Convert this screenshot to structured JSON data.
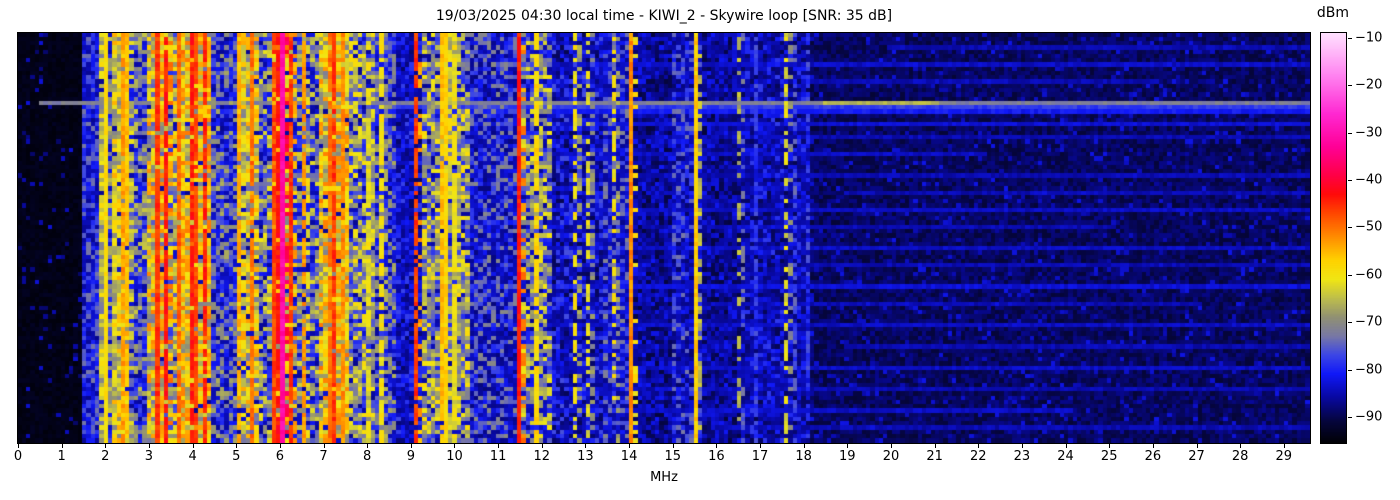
{
  "figure": {
    "title": "19/03/2025 04:30 local time - KIWI_2 - Skywire loop [SNR: 35 dB]",
    "xlabel": "MHz",
    "colorbar_label": "dBm",
    "background": "#ffffff"
  },
  "chart_data": {
    "type": "heatmap",
    "title": "19/03/2025 04:30 local time - KIWI_2 - Skywire loop [SNR: 35 dB]",
    "xlabel": "MHz",
    "ylabel": "",
    "colorbar_label": "dBm",
    "x_range_mhz": [
      0,
      29.6
    ],
    "xticks": [
      0,
      1,
      2,
      3,
      4,
      5,
      6,
      7,
      8,
      9,
      10,
      11,
      12,
      13,
      14,
      15,
      16,
      17,
      18,
      19,
      20,
      21,
      22,
      23,
      24,
      25,
      26,
      27,
      28,
      29
    ],
    "colorbar_ticks": [
      -10,
      -20,
      -30,
      -40,
      -50,
      -60,
      -70,
      -80,
      -90
    ],
    "colorbar_tick_labels": [
      "−10",
      "−20",
      "−30",
      "−40",
      "−50",
      "−60",
      "−70",
      "−80",
      "−90"
    ],
    "value_range_dbm": [
      -95.5,
      -9
    ],
    "grid": {
      "cols": 300,
      "rows": 96,
      "seed": 1337
    },
    "colormap_stops": [
      [
        -96,
        [
          0,
          0,
          0
        ]
      ],
      [
        -91,
        [
          5,
          5,
          60
        ]
      ],
      [
        -86,
        [
          8,
          8,
          160
        ]
      ],
      [
        -81,
        [
          16,
          24,
          248
        ]
      ],
      [
        -77,
        [
          60,
          70,
          230
        ]
      ],
      [
        -73,
        [
          120,
          120,
          165
        ]
      ],
      [
        -69,
        [
          145,
          145,
          115
        ]
      ],
      [
        -65,
        [
          190,
          190,
          75
        ]
      ],
      [
        -61,
        [
          240,
          230,
          20
        ]
      ],
      [
        -57,
        [
          255,
          210,
          0
        ]
      ],
      [
        -52,
        [
          255,
          140,
          0
        ]
      ],
      [
        -47,
        [
          255,
          70,
          0
        ]
      ],
      [
        -43,
        [
          255,
          10,
          10
        ]
      ],
      [
        -39,
        [
          255,
          0,
          70
        ]
      ],
      [
        -33,
        [
          255,
          0,
          150
        ]
      ],
      [
        -26,
        [
          255,
          40,
          210
        ]
      ],
      [
        -18,
        [
          255,
          130,
          240
        ]
      ],
      [
        -9,
        [
          255,
          225,
          255
        ]
      ]
    ],
    "quiet_zone_mhz": [
      0,
      1.45
    ],
    "hf_quiet_above_mhz": 18.2,
    "bands": [
      {
        "f0": 1.45,
        "f1": 1.92,
        "level": -80,
        "var": 7,
        "density": 0.85
      },
      {
        "f0": 1.92,
        "f1": 2.1,
        "level": -66,
        "var": 8,
        "density": 0.9
      },
      {
        "f0": 2.1,
        "f1": 2.22,
        "level": -77,
        "var": 8,
        "density": 0.85
      },
      {
        "f0": 2.22,
        "f1": 2.6,
        "level": -63,
        "var": 9,
        "density": 0.92
      },
      {
        "f0": 2.6,
        "f1": 3.0,
        "level": -74,
        "var": 10,
        "density": 0.85
      },
      {
        "f0": 3.0,
        "f1": 3.4,
        "level": -63,
        "var": 12,
        "density": 0.95
      },
      {
        "f0": 3.4,
        "f1": 3.65,
        "level": -67,
        "var": 12,
        "density": 0.92
      },
      {
        "f0": 3.65,
        "f1": 4.05,
        "level": -60,
        "var": 11,
        "density": 0.95
      },
      {
        "f0": 4.05,
        "f1": 4.45,
        "level": -63,
        "var": 12,
        "density": 0.92
      },
      {
        "f0": 4.45,
        "f1": 5.0,
        "level": -76,
        "var": 10,
        "density": 0.85
      },
      {
        "f0": 5.0,
        "f1": 5.5,
        "level": -64,
        "var": 11,
        "density": 0.9
      },
      {
        "f0": 5.5,
        "f1": 5.78,
        "level": -71,
        "var": 11,
        "density": 0.85
      },
      {
        "f0": 5.78,
        "f1": 6.3,
        "level": -60,
        "var": 12,
        "density": 0.93
      },
      {
        "f0": 6.3,
        "f1": 6.95,
        "level": -73,
        "var": 11,
        "density": 0.85
      },
      {
        "f0": 6.95,
        "f1": 7.6,
        "level": -61,
        "var": 11,
        "density": 0.93
      },
      {
        "f0": 7.6,
        "f1": 8.15,
        "level": -69,
        "var": 11,
        "density": 0.85
      },
      {
        "f0": 8.15,
        "f1": 8.7,
        "level": -75,
        "var": 9,
        "density": 0.8
      },
      {
        "f0": 8.7,
        "f1": 9.3,
        "level": -83,
        "var": 6,
        "density": 0.75
      },
      {
        "f0": 9.3,
        "f1": 10.4,
        "level": -69,
        "var": 11,
        "density": 0.85
      },
      {
        "f0": 10.4,
        "f1": 11.4,
        "level": -79,
        "var": 9,
        "density": 0.75
      },
      {
        "f0": 11.4,
        "f1": 12.2,
        "level": -71,
        "var": 11,
        "density": 0.8
      },
      {
        "f0": 12.2,
        "f1": 13.4,
        "level": -83,
        "var": 7,
        "density": 0.65
      },
      {
        "f0": 13.4,
        "f1": 14.1,
        "level": -79,
        "var": 8,
        "density": 0.7
      },
      {
        "f0": 14.1,
        "f1": 15.0,
        "level": -86,
        "var": 5,
        "density": 0.6
      },
      {
        "f0": 15.0,
        "f1": 15.65,
        "level": -81,
        "var": 8,
        "density": 0.65
      },
      {
        "f0": 15.65,
        "f1": 16.6,
        "level": -86,
        "var": 5,
        "density": 0.55
      },
      {
        "f0": 16.6,
        "f1": 18.2,
        "level": -84,
        "var": 6,
        "density": 0.6
      }
    ],
    "carriers": [
      {
        "f": 1.98,
        "level": -59,
        "duty": 1.0
      },
      {
        "f": 2.32,
        "level": -53,
        "duty": 0.9
      },
      {
        "f": 2.47,
        "level": -56,
        "duty": 0.85
      },
      {
        "f": 3.2,
        "level": -46,
        "duty": 0.95
      },
      {
        "f": 3.33,
        "level": -44,
        "duty": 0.9
      },
      {
        "f": 3.62,
        "level": -49,
        "duty": 0.85
      },
      {
        "f": 3.9,
        "level": -44,
        "duty": 0.9
      },
      {
        "f": 4.07,
        "level": -47,
        "duty": 0.85
      },
      {
        "f": 4.22,
        "level": -45,
        "duty": 0.85
      },
      {
        "f": 5.0,
        "level": -55,
        "duty": 0.8
      },
      {
        "f": 5.35,
        "level": -50,
        "duty": 0.85
      },
      {
        "f": 5.8,
        "level": -47,
        "duty": 0.9
      },
      {
        "f": 5.95,
        "level": -43,
        "duty": 0.85
      },
      {
        "f": 6.0,
        "level": -31,
        "duty": 1.0
      },
      {
        "f": 6.17,
        "level": -46,
        "duty": 0.85
      },
      {
        "f": 6.5,
        "level": -53,
        "duty": 0.8
      },
      {
        "f": 7.1,
        "level": -50,
        "duty": 0.85
      },
      {
        "f": 7.25,
        "level": -46,
        "duty": 0.9
      },
      {
        "f": 7.4,
        "level": -52,
        "duty": 0.8
      },
      {
        "f": 8.0,
        "level": -62,
        "duty": 0.7
      },
      {
        "f": 8.33,
        "level": -60,
        "duty": 0.75
      },
      {
        "f": 9.1,
        "level": -46,
        "duty": 0.85
      },
      {
        "f": 9.65,
        "level": -56,
        "duty": 0.95
      },
      {
        "f": 9.78,
        "level": -58,
        "duty": 0.9
      },
      {
        "f": 10.0,
        "level": -61,
        "duty": 0.75
      },
      {
        "f": 11.47,
        "level": -44,
        "duty": 1.0
      },
      {
        "f": 11.8,
        "level": -58,
        "duty": 0.75
      },
      {
        "f": 12.77,
        "level": -60,
        "duty": 0.55
      },
      {
        "f": 13.05,
        "level": -62,
        "duty": 0.5
      },
      {
        "f": 13.57,
        "level": -60,
        "duty": 0.5
      },
      {
        "f": 13.99,
        "level": -52,
        "duty": 1.0
      },
      {
        "f": 15.5,
        "level": -57,
        "duty": 1.0
      },
      {
        "f": 16.5,
        "level": -66,
        "duty": 0.35
      },
      {
        "f": 16.85,
        "level": -78,
        "duty": 0.6
      },
      {
        "f": 17.55,
        "level": -62,
        "duty": 0.45
      },
      {
        "f": 17.8,
        "level": -76,
        "duty": 0.5
      },
      {
        "f": 18.05,
        "level": -78,
        "duty": 0.5
      }
    ],
    "streaks": [
      {
        "row": 16,
        "f0": 0.5,
        "f1": 29.6,
        "level": -72
      },
      {
        "row": 16,
        "f0": 18.5,
        "f1": 21.0,
        "level": -66
      },
      {
        "row": 17,
        "f0": 8.0,
        "f1": 29.6,
        "level": -78
      },
      {
        "row": 18,
        "f0": 10.0,
        "f1": 29.6,
        "level": -81
      },
      {
        "row": 3,
        "f0": 20.0,
        "f1": 29.6,
        "level": -85
      },
      {
        "row": 7,
        "f0": 12.0,
        "f1": 29.6,
        "level": -84
      },
      {
        "row": 11,
        "f0": 18.0,
        "f1": 26.0,
        "level": -85
      },
      {
        "row": 21,
        "f0": 9.0,
        "f1": 29.6,
        "level": -83
      },
      {
        "row": 24,
        "f0": 14.0,
        "f1": 29.6,
        "level": -85
      },
      {
        "row": 28,
        "f0": 10.0,
        "f1": 22.0,
        "level": -84
      },
      {
        "row": 33,
        "f0": 13.0,
        "f1": 29.6,
        "level": -85
      },
      {
        "row": 37,
        "f0": 19.0,
        "f1": 29.6,
        "level": -85
      },
      {
        "row": 41,
        "f0": 9.0,
        "f1": 29.6,
        "level": -84
      },
      {
        "row": 45,
        "f0": 15.0,
        "f1": 25.0,
        "level": -85
      },
      {
        "row": 50,
        "f0": 11.0,
        "f1": 29.6,
        "level": -84
      },
      {
        "row": 54,
        "f0": 18.0,
        "f1": 29.6,
        "level": -85
      },
      {
        "row": 59,
        "f0": 9.0,
        "f1": 29.6,
        "level": -83
      },
      {
        "row": 63,
        "f0": 16.0,
        "f1": 27.0,
        "level": -85
      },
      {
        "row": 68,
        "f0": 12.0,
        "f1": 29.6,
        "level": -84
      },
      {
        "row": 73,
        "f0": 19.0,
        "f1": 29.6,
        "level": -85
      },
      {
        "row": 78,
        "f0": 10.0,
        "f1": 29.6,
        "level": -84
      },
      {
        "row": 83,
        "f0": 14.0,
        "f1": 29.6,
        "level": -85
      },
      {
        "row": 88,
        "f0": 11.0,
        "f1": 24.0,
        "level": -84
      },
      {
        "row": 92,
        "f0": 16.0,
        "f1": 29.6,
        "level": -85
      }
    ]
  }
}
